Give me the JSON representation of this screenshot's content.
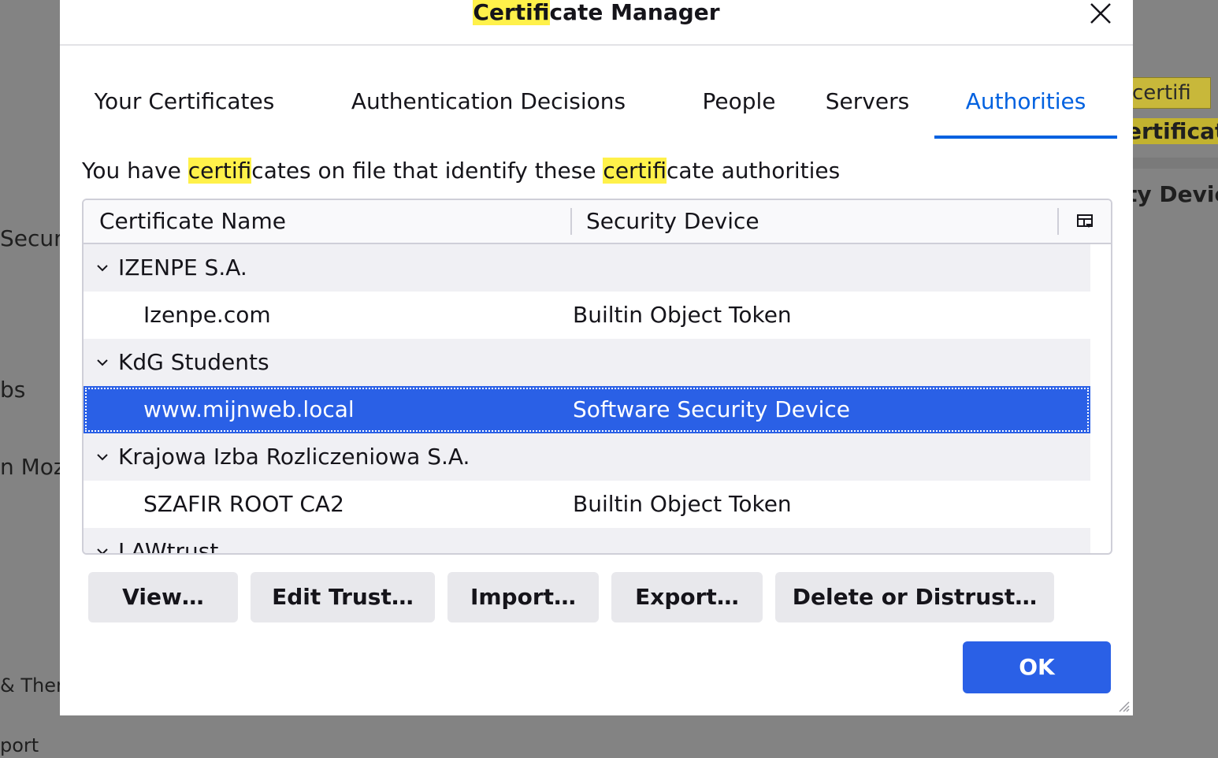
{
  "background": {
    "fragments": [
      "Secur",
      "bs",
      "n Moz",
      "& Them",
      "port"
    ],
    "right_fragments": {
      "tooltip": "certifi",
      "heading": "ertificat",
      "device_label": "ty Devic"
    }
  },
  "dialog": {
    "title_highlight": "Certifi",
    "title_rest": "cate Manager",
    "close_icon": "close-icon",
    "tabs": [
      "Your Certificates",
      "Authentication Decisions",
      "People",
      "Servers",
      "Authorities"
    ],
    "active_tab": "Authorities",
    "description": {
      "p1": "You have ",
      "h1": "certifi",
      "p2": "cates on file that identify these ",
      "h2": "certifi",
      "p3": "cate authorities"
    },
    "columns": [
      "Certificate Name",
      "Security Device"
    ],
    "rows": [
      {
        "type": "group",
        "name": "IZENPE S.A."
      },
      {
        "type": "item",
        "name": "Izenpe.com",
        "device": "Builtin Object Token"
      },
      {
        "type": "group",
        "name": "KdG Students"
      },
      {
        "type": "item",
        "name": "www.mijnweb.local",
        "device": "Software Security Device",
        "selected": true
      },
      {
        "type": "group",
        "name": "Krajowa Izba Rozliczeniowa S.A."
      },
      {
        "type": "item",
        "name": "SZAFIR ROOT CA2",
        "device": "Builtin Object Token"
      },
      {
        "type": "group",
        "name": "LAWtrust"
      }
    ],
    "buttons": [
      "View…",
      "Edit Trust…",
      "Import…",
      "Export…",
      "Delete or Distrust…"
    ],
    "ok_label": "OK",
    "colors": {
      "accent": "#0061e0",
      "selection": "#2a60e6",
      "highlight": "#fff14a"
    }
  }
}
